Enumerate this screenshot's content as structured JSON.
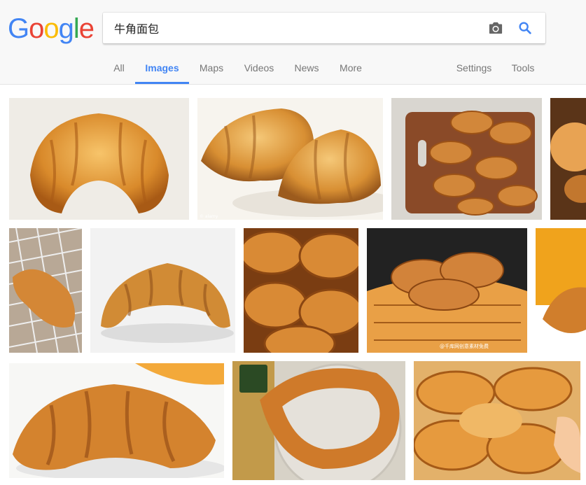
{
  "logo": {
    "letters": [
      "G",
      "o",
      "o",
      "g",
      "l",
      "e"
    ],
    "colors": [
      "#4285f4",
      "#ea4335",
      "#fbbc05",
      "#4285f4",
      "#34a853",
      "#ea4335"
    ]
  },
  "search": {
    "query": "牛角面包",
    "camera_icon": "camera-icon",
    "search_icon": "search-icon"
  },
  "tabs": {
    "all": "All",
    "images": "Images",
    "maps": "Maps",
    "videos": "Videos",
    "news": "News",
    "more": "More",
    "settings": "Settings",
    "tools": "Tools"
  },
  "results": {
    "watermark_1": "© alamy",
    "watermark_2": "@千库网创意素材免费"
  },
  "colors": {
    "accent": "#4285f4",
    "header_bg": "#f8f8f8",
    "tab_text": "#777777"
  }
}
